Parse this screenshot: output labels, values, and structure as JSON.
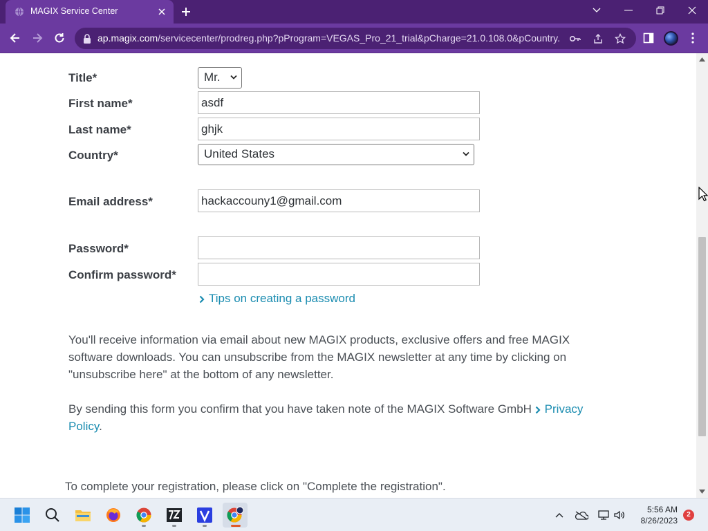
{
  "browser": {
    "tab_title": "MAGIX Service Center",
    "url_host": "ap.magix.com",
    "url_path": "/servicecenter/prodreg.php?pProgram=VEGAS_Pro_21_trial&pCharge=21.0.108.0&pCountry..."
  },
  "form": {
    "title_label": "Title*",
    "title_value": "Mr.",
    "first_name_label": "First name*",
    "first_name_value": "asdf",
    "last_name_label": "Last name*",
    "last_name_value": "ghjk",
    "country_label": "Country*",
    "country_value": "United States",
    "email_label": "Email address*",
    "email_value": "hackaccouny1@gmail.com",
    "password_label": "Password*",
    "password_value": "",
    "confirm_label": "Confirm password*",
    "confirm_value": "",
    "tips_link": "Tips on creating a password"
  },
  "content": {
    "newsletter_text": "You'll receive information via email about new MAGIX products, exclusive offers and free MAGIX software downloads. You can unsubscribe from the MAGIX newsletter at any time by clicking on \"unsubscribe here\" at the bottom of any newsletter.",
    "privacy_text": "By sending this form you confirm that you have taken note of the MAGIX Software GmbH",
    "privacy_link": "Privacy Policy",
    "privacy_period": ".",
    "complete_text": "To complete your registration, please click on \"Complete the registration\"."
  },
  "taskbar": {
    "apps": [
      "start-icon",
      "search-icon",
      "file-explorer-icon",
      "firefox-icon",
      "chrome-icon",
      "7zip-icon",
      "vegas-icon",
      "chrome-active-icon"
    ],
    "time": "5:56 AM",
    "date": "8/26/2023",
    "notification_count": "2"
  },
  "colors": {
    "browser_frame": "#4b2173",
    "browser_toolbar": "#6b3aa0",
    "link": "#1a8cb0"
  }
}
